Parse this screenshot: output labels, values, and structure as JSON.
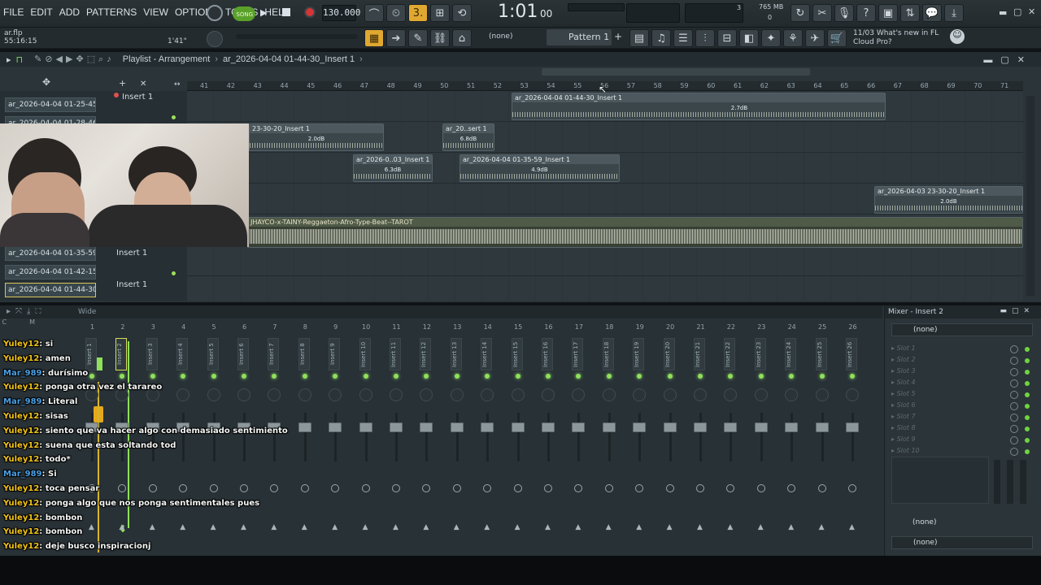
{
  "menu": [
    "FILE",
    "EDIT",
    "ADD",
    "PATTERNS",
    "VIEW",
    "OPTIONS",
    "TOOLS",
    "HELP"
  ],
  "transport": {
    "song_label": "SONG",
    "tempo": "130.000",
    "time": "1:01",
    "time_sub": "00",
    "pattern": "Pattern 1",
    "none_label": "(none)"
  },
  "info": {
    "file": "ar.flp",
    "time": "55:16:15",
    "duration": "1'41\"",
    "cpu": "3",
    "mem": "765 MB",
    "mem2": "0",
    "news_date": "11/03",
    "news_text": "What's new in FL Cloud Pro?"
  },
  "playlist": {
    "title": "Playlist - Arrangement",
    "breadcrumb": "ar_2026-04-04 01-44-30_Insert 1",
    "ruler": [
      "41",
      "42",
      "43",
      "44",
      "45",
      "46",
      "47",
      "48",
      "49",
      "50",
      "51",
      "52",
      "53",
      "54",
      "55",
      "56",
      "57",
      "58",
      "59",
      "60",
      "61",
      "62",
      "63",
      "64",
      "65",
      "66",
      "67",
      "68",
      "69",
      "70",
      "71"
    ],
    "left_items": [
      "ar_2026-04-04 01-25-45...",
      "ar_2026-04-04 01-28-46...",
      "ar_2026-04-04 01-35-59...",
      "ar_2026-04-04 01-42-15...",
      "ar_2026-04-04 01-44-30..."
    ],
    "track_names": [
      "Insert 1",
      "Insert 1",
      "Insert 1"
    ],
    "clips": [
      {
        "label": "ar_2026-04-04 01-44-30_Insert 1",
        "gain": "2.7dB"
      },
      {
        "label": "23-30-20_Insert 1",
        "gain": "2.0dB"
      },
      {
        "label": "ar_20..sert 1",
        "gain": "6.8dB"
      },
      {
        "label": "ar_2026-0..03_Insert 1",
        "gain": "6.3dB"
      },
      {
        "label": "ar_2026-04-04 01-35-59_Insert 1",
        "gain": "4.9dB"
      },
      {
        "label": "ar_2026-04-03 23-30-20_Insert 1",
        "gain": "2.0dB"
      },
      {
        "label": "JHAYCO-x-TAINY-Reggaeton-Afro-Type-Beat--TAROT",
        "gain": ""
      }
    ]
  },
  "mixer": {
    "view": "Wide",
    "panel_title": "Mixer - Insert 2",
    "none1": "(none)",
    "none2": "(none)",
    "none3": "(none)",
    "numbers": [
      "1",
      "2",
      "3",
      "4",
      "5",
      "6",
      "7",
      "8",
      "9",
      "10",
      "11",
      "12",
      "13",
      "14",
      "15",
      "16",
      "17",
      "18",
      "19",
      "20",
      "21",
      "22",
      "23",
      "24",
      "25",
      "26"
    ],
    "names": [
      "Insert 1",
      "Insert 2",
      "Insert 3",
      "Insert 4",
      "Insert 5",
      "Insert 6",
      "Insert 7",
      "Insert 8",
      "Insert 9",
      "Insert 10",
      "Insert 11",
      "Insert 12",
      "Insert 13",
      "Insert 14",
      "Insert 15",
      "Insert 16",
      "Insert 17",
      "Insert 18",
      "Insert 19",
      "Insert 20",
      "Insert 21",
      "Insert 22",
      "Insert 23",
      "Insert 24",
      "Insert 25",
      "Insert 26"
    ],
    "slots": [
      "Slot 1",
      "Slot 2",
      "Slot 3",
      "Slot 4",
      "Slot 5",
      "Slot 6",
      "Slot 7",
      "Slot 8",
      "Slot 9",
      "Slot 10"
    ]
  },
  "chat": [
    {
      "user": "Yuley12",
      "msg": ": si",
      "color": "y"
    },
    {
      "user": "Yuley12",
      "msg": ": amen",
      "color": "y"
    },
    {
      "user": "Mar_989",
      "msg": ": durísimo",
      "color": "m"
    },
    {
      "user": "Yuley12",
      "msg": ": ponga otra vez el tarareo",
      "color": "y"
    },
    {
      "user": "Mar_989",
      "msg": ": Literal",
      "color": "m"
    },
    {
      "user": "Yuley12",
      "msg": ": sisas",
      "color": "y"
    },
    {
      "user": "Yuley12",
      "msg": ": siento que va hacer algo con demasiado sentimiento",
      "color": "y"
    },
    {
      "user": "Yuley12",
      "msg": ": suena que esta soltando tod",
      "color": "y"
    },
    {
      "user": "Yuley12",
      "msg": ": todo*",
      "color": "y"
    },
    {
      "user": "Mar_989",
      "msg": ": Si",
      "color": "m"
    },
    {
      "user": "Yuley12",
      "msg": ": toca pensar",
      "color": "y"
    },
    {
      "user": "Yuley12",
      "msg": ": ponga algo que nos ponga sentimentales pues",
      "color": "y"
    },
    {
      "user": "Yuley12",
      "msg": ": bombon",
      "color": "y"
    },
    {
      "user": "Yuley12",
      "msg": ": bombon",
      "color": "y"
    },
    {
      "user": "Yuley12",
      "msg": ": deje busco inspiracionj",
      "color": "y"
    }
  ]
}
